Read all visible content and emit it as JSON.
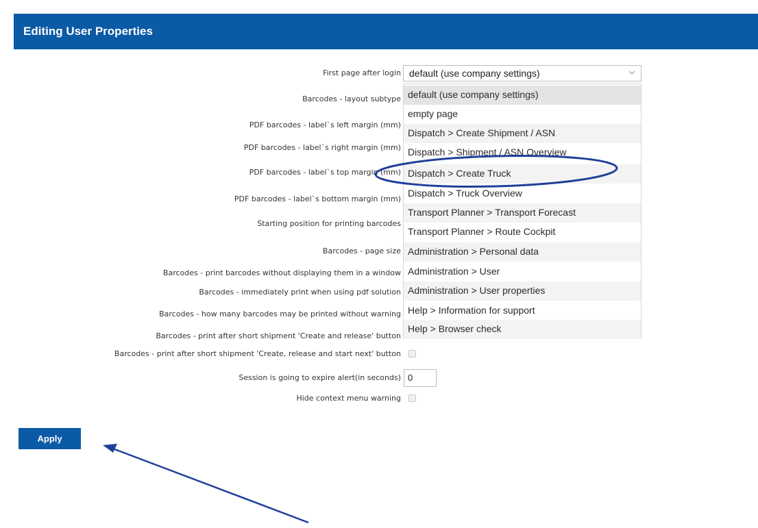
{
  "header": {
    "title": "Editing User Properties"
  },
  "form": {
    "labels": [
      "First page after login",
      "Barcodes - layout subtype",
      "PDF barcodes - label`s left margin (mm)",
      "PDF barcodes - label`s right margin (mm)",
      "PDF barcodes - label`s top margin (mm)",
      "PDF barcodes - label`s bottom margin (mm)",
      "Starting position for printing barcodes",
      "Barcodes - page size",
      "Barcodes - print barcodes without displaying them in a window",
      "Barcodes - immediately print when using pdf solution",
      "Barcodes - how many barcodes may be printed without warning",
      "Barcodes - print after short shipment 'Create and release' button",
      "Barcodes - print after short shipment 'Create, release and start next' button",
      "Session is going to expire alert(in seconds)",
      "Hide context menu warning"
    ],
    "first_page_select": {
      "value": "default (use company settings)",
      "icon": "chevron-down-icon",
      "options": [
        "default (use company settings)",
        "empty page",
        "Dispatch > Create Shipment / ASN",
        "Dispatch > Shipment / ASN Overview",
        "Dispatch > Create Truck",
        "Dispatch > Truck Overview",
        "Transport Planner > Transport Forecast",
        "Transport Planner > Route Cockpit",
        "Administration > Personal data",
        "Administration > User",
        "Administration > User properties",
        "Help > Information for support",
        "Help > Browser check"
      ]
    },
    "session_expire_value": "0",
    "apply_label": "Apply"
  },
  "colors": {
    "header_bg": "#0b5aa6",
    "button_bg": "#0b5aa6",
    "annotation": "#1f3f9a"
  }
}
